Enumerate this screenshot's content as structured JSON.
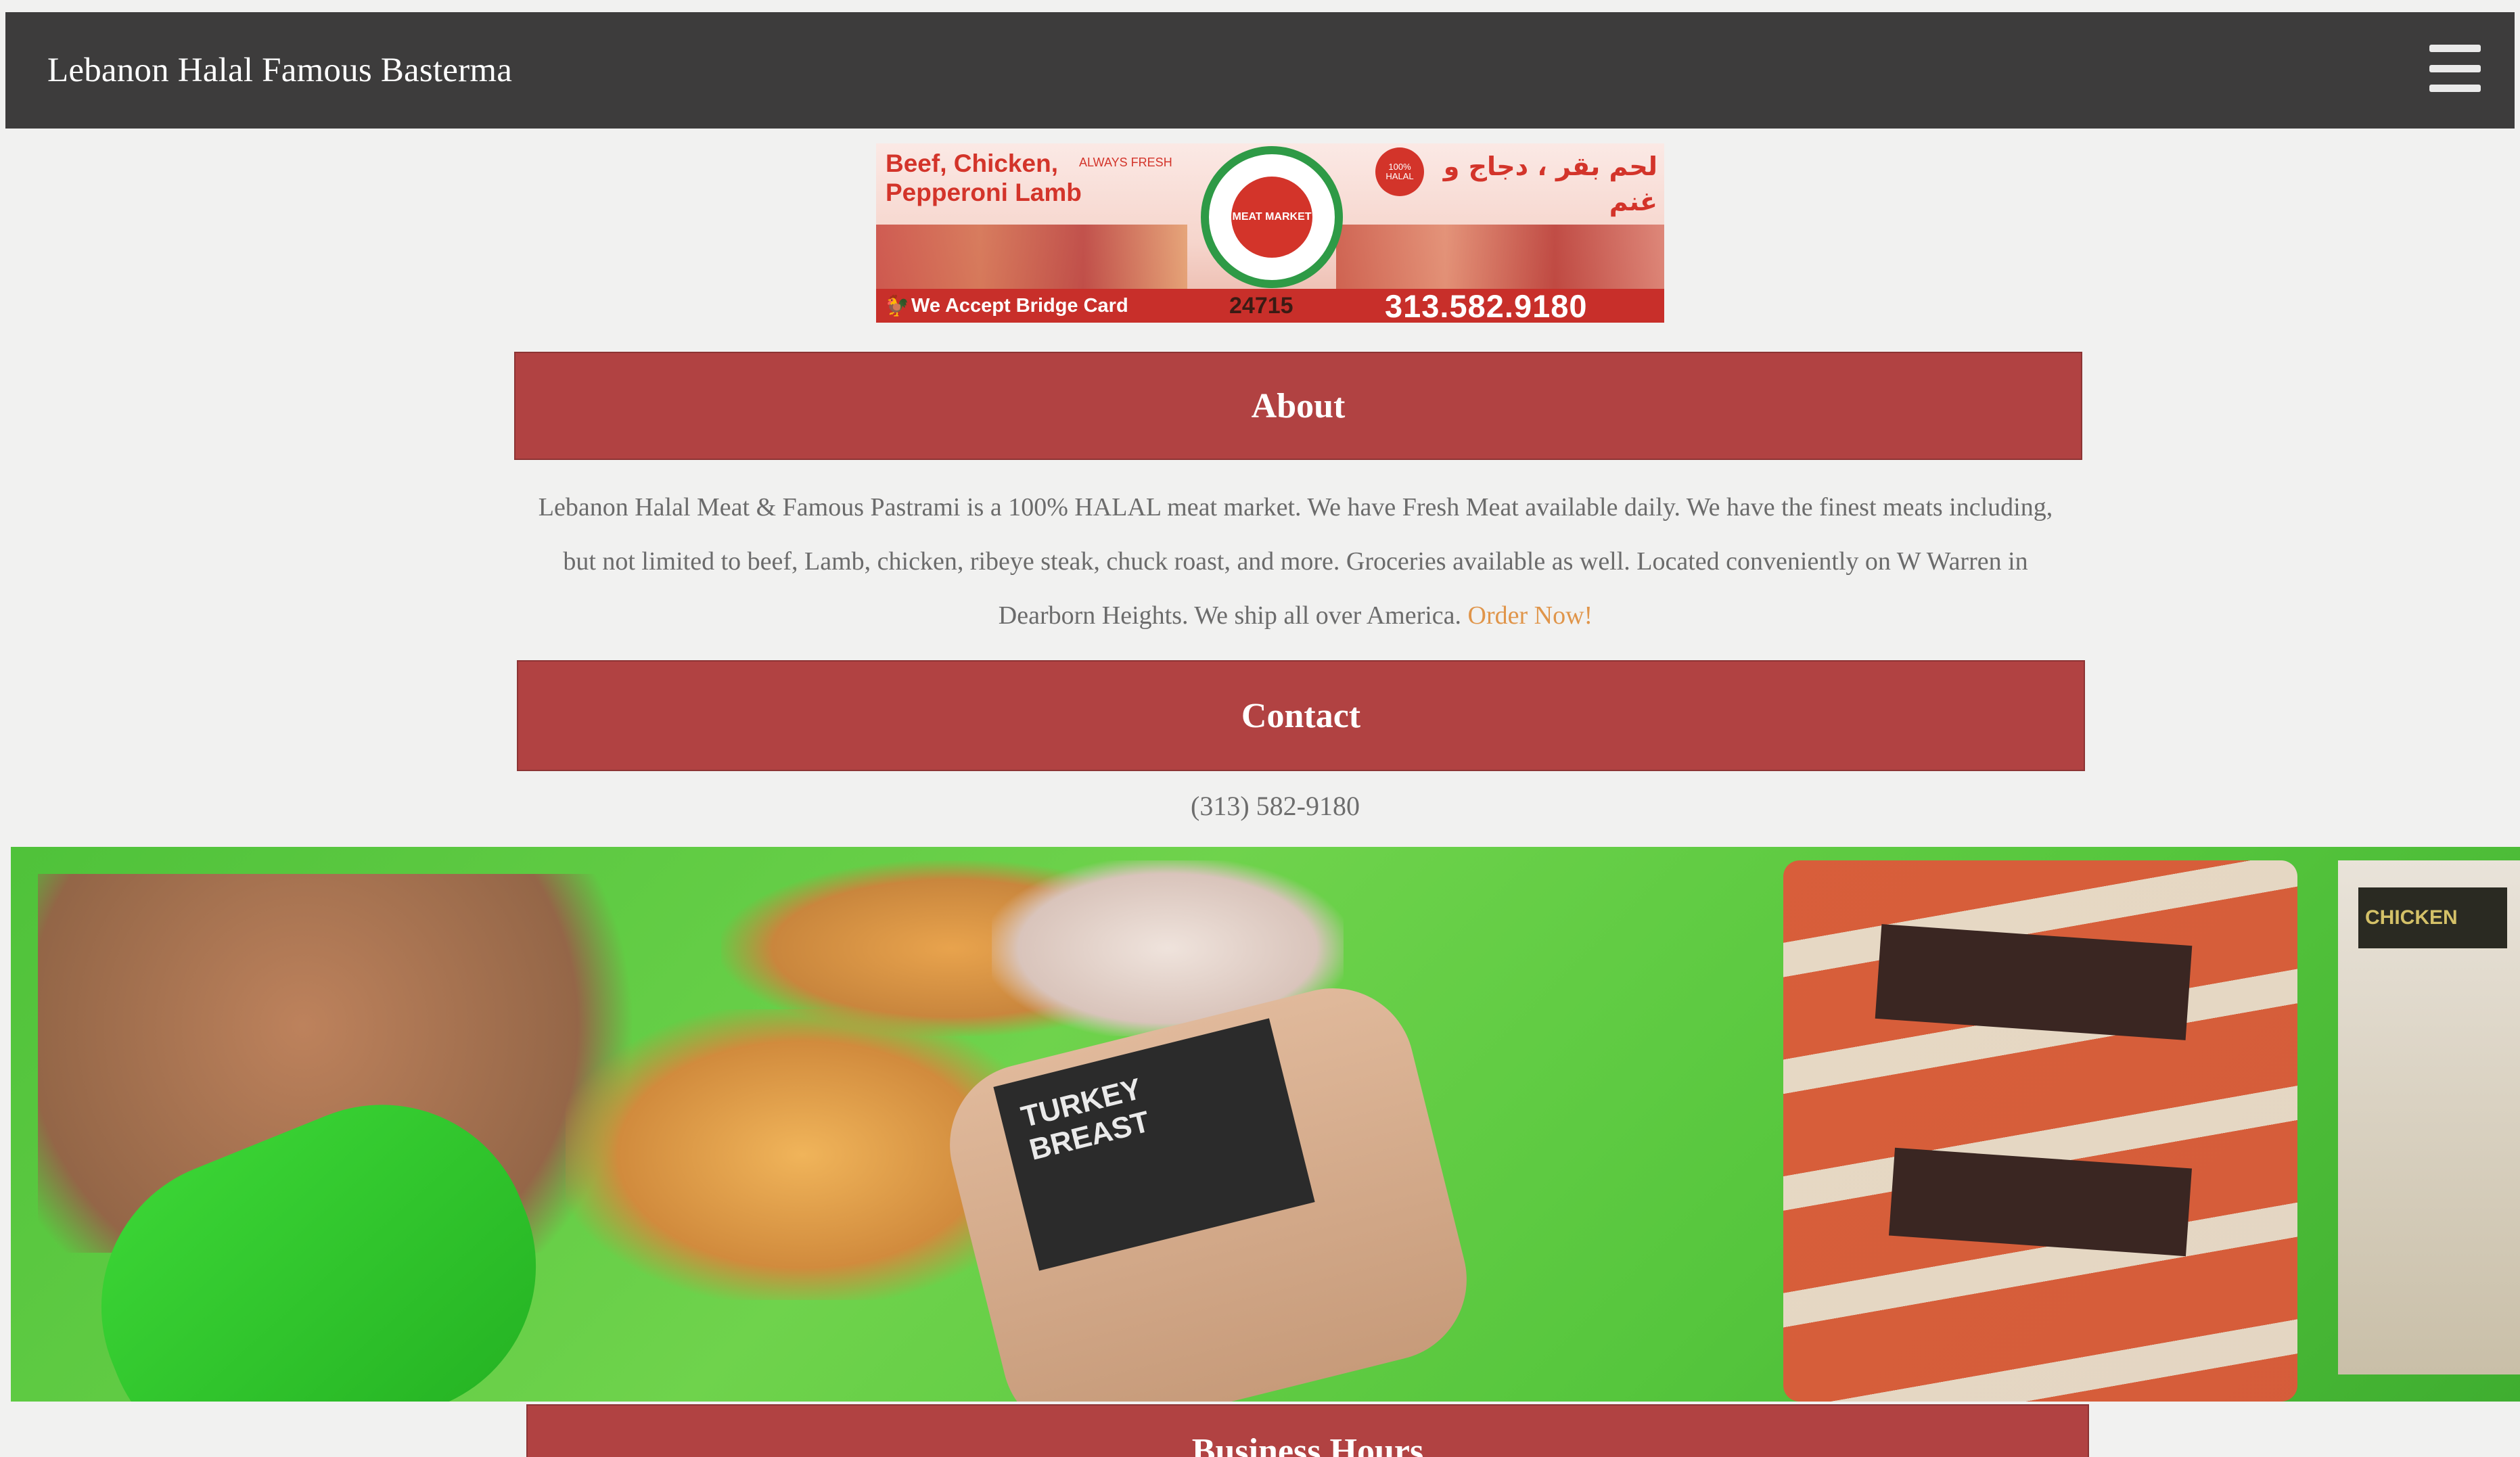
{
  "navbar": {
    "brand": "Lebanon Halal Famous Basterma",
    "menu_icon": "hamburger-menu-icon"
  },
  "banner": {
    "en_products": "Beef, Chicken, Pepperoni Lamb",
    "always_fresh": "ALWAYS FRESH",
    "ar_products": "لحم بقر ، دجاج و غنم",
    "logo_text": "MEAT MARKET",
    "badge_text": "100% HALAL",
    "bridge_card": "We Accept Bridge Card",
    "zip": "24715",
    "phone": "313.582.9180"
  },
  "about": {
    "title": "About",
    "text": "Lebanon Halal Meat & Famous Pastrami is a 100% HALAL meat market. We have Fresh Meat available daily. We have the finest meats including, but not limited to beef, Lamb, chicken, ribeye steak, chuck roast, and more. Groceries available as well. Located conveniently on W Warren in Dearborn Heights. We ship all over America.",
    "link": "Order Now!"
  },
  "contact": {
    "title": "Contact",
    "phone": "(313) 582-9180"
  },
  "photo": {
    "roll_label": "TURKEY BREAST",
    "side_label": "CHICKEN"
  },
  "hours": {
    "title": "Business Hours"
  },
  "colors": {
    "navbar": "#3d3c3c",
    "section_header": "#b14242",
    "link": "#e0954a",
    "body_text": "#6b6b6b"
  }
}
